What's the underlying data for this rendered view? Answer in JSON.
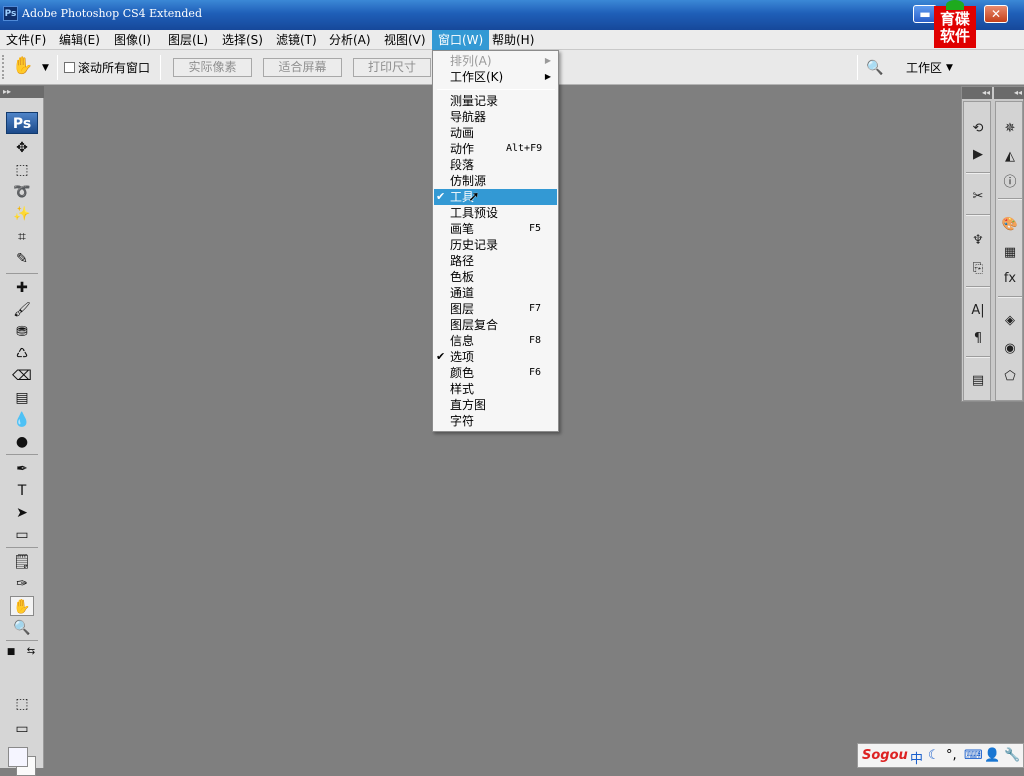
{
  "titlebar": {
    "logo": "Ps",
    "title": "Adobe Photoshop CS4 Extended",
    "min": "▬",
    "close": "✕"
  },
  "watermark": {
    "line1": "育碟",
    "line2": "软件"
  },
  "menubar": [
    "文件(F)",
    "编辑(E)",
    "图像(I)",
    "图层(L)",
    "选择(S)",
    "滤镜(T)",
    "分析(A)",
    "视图(V)",
    "窗口(W)",
    "帮助(H)"
  ],
  "options": {
    "tool_icon": "hand-icon",
    "scroll_all": "滚动所有窗口",
    "actual_pixels": "实际像素",
    "fit_screen": "适合屏幕",
    "print_size": "打印尺寸",
    "workspace": "工作区"
  },
  "toolbox": {
    "logo": "Ps"
  },
  "window_menu": {
    "items": [
      {
        "label": "排列(A)",
        "disabled": true,
        "submenu": true
      },
      {
        "label": "工作区(K)",
        "submenu": true
      },
      {
        "label": "测量记录"
      },
      {
        "label": "导航器"
      },
      {
        "label": "动画"
      },
      {
        "label": "动作",
        "shortcut": "Alt+F9"
      },
      {
        "label": "段落"
      },
      {
        "label": "仿制源"
      },
      {
        "label": "工具",
        "checked": true,
        "highlighted": true
      },
      {
        "label": "工具预设"
      },
      {
        "label": "画笔",
        "shortcut": "F5"
      },
      {
        "label": "历史记录"
      },
      {
        "label": "路径"
      },
      {
        "label": "色板"
      },
      {
        "label": "通道"
      },
      {
        "label": "图层",
        "shortcut": "F7"
      },
      {
        "label": "图层复合"
      },
      {
        "label": "信息",
        "shortcut": "F8"
      },
      {
        "label": "选项",
        "checked": true
      },
      {
        "label": "颜色",
        "shortcut": "F6"
      },
      {
        "label": "样式"
      },
      {
        "label": "直方图"
      },
      {
        "label": "字符"
      }
    ]
  },
  "ime": {
    "logo": "Sogou",
    "mode": "中"
  }
}
